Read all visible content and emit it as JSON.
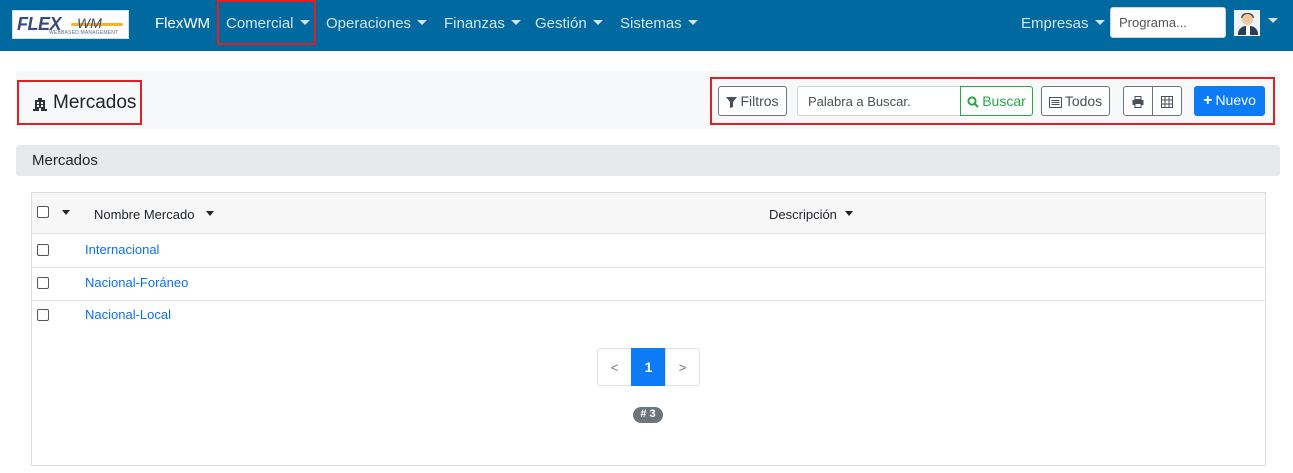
{
  "navbar": {
    "logo_text": "FLEX",
    "logo_text_2": "WM",
    "logo_subtitle": "WEBBASED MANAGEMENT",
    "brand": "FlexWM",
    "menu": [
      {
        "label": "Comercial"
      },
      {
        "label": "Operaciones"
      },
      {
        "label": "Finanzas"
      },
      {
        "label": "Gestión"
      },
      {
        "label": "Sistemas"
      }
    ],
    "empresas_label": "Empresas",
    "program_search": {
      "placeholder": "Programa..."
    },
    "avatar_icon": "user-avatar-icon",
    "color": "#006aa0"
  },
  "page": {
    "title": "Mercados",
    "title_icon": "building-icon"
  },
  "toolbar": {
    "filters_label": "Filtros",
    "search_placeholder": "Palabra a Buscar.",
    "search_button_label": "Buscar",
    "all_label": "Todos",
    "print_icon": "print-icon",
    "grid_icon": "table-icon",
    "new_label": "Nuevo"
  },
  "section": {
    "title": "Mercados"
  },
  "table": {
    "columns": [
      {
        "label": "Nombre Mercado"
      },
      {
        "label": "Descripción"
      }
    ],
    "rows": [
      {
        "name": "Internacional",
        "description": ""
      },
      {
        "name": "Nacional-Foráneo",
        "description": ""
      },
      {
        "name": "Nacional-Local",
        "description": ""
      }
    ]
  },
  "pagination": {
    "prev": "<",
    "current": "1",
    "next": ">",
    "total_badge": "# 3"
  },
  "colors": {
    "accent": "#0d7bf5",
    "success": "#28a745",
    "highlight": "#e02020"
  }
}
